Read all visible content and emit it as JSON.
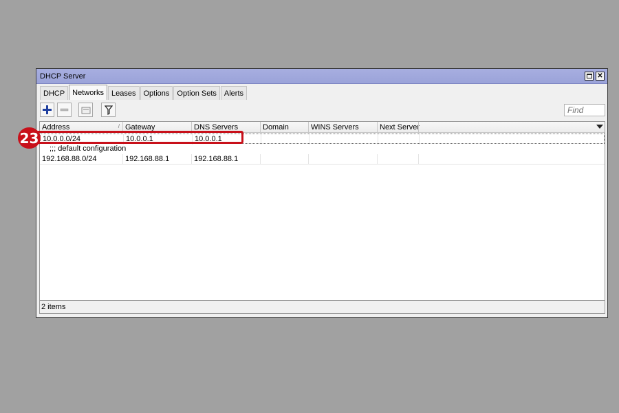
{
  "window": {
    "title": "DHCP Server"
  },
  "tabs": [
    {
      "label": "DHCP",
      "active": false
    },
    {
      "label": "Networks",
      "active": true
    },
    {
      "label": "Leases",
      "active": false
    },
    {
      "label": "Options",
      "active": false
    },
    {
      "label": "Option Sets",
      "active": false
    },
    {
      "label": "Alerts",
      "active": false
    }
  ],
  "toolbar": {
    "add_icon": "plus-icon",
    "remove_icon": "minus-icon",
    "comment_icon": "comment-icon",
    "filter_icon": "filter-icon",
    "find_placeholder": "Find"
  },
  "table": {
    "columns": [
      "Address",
      "Gateway",
      "DNS Servers",
      "Domain",
      "WINS Servers",
      "Next Server"
    ],
    "sort_indicator": "/",
    "rows": [
      {
        "address": "10.0.0.0/24",
        "gateway": "10.0.0.1",
        "dns": "10.0.0.1",
        "domain": "",
        "wins": "",
        "next": ""
      },
      {
        "comment": ";;; default configuration"
      },
      {
        "address": "192.168.88.0/24",
        "gateway": "192.168.88.1",
        "dns": "192.168.88.1",
        "domain": "",
        "wins": "",
        "next": ""
      }
    ]
  },
  "status": {
    "items": "2 items"
  },
  "annotation": {
    "number": "23",
    "color": "#c8101a"
  },
  "colors": {
    "titlebar": "#a7aee0",
    "background": "#a1a1a1",
    "add_icon": "#1f3f9f"
  }
}
